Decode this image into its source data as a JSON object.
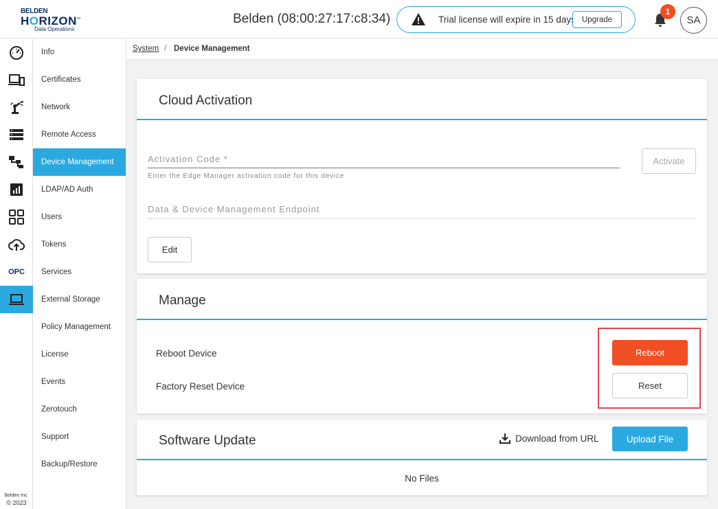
{
  "header": {
    "logo_line1": "BELDEN",
    "logo_line2_a": "H",
    "logo_line2_o": "O",
    "logo_line2_b": "RIZON",
    "logo_tm": "™",
    "logo_line3": "Data Operations",
    "device_title": "Belden (08:00:27:17:c8:34)",
    "license_message": "Trial license will expire in 15 days",
    "upgrade_label": "Upgrade",
    "notification_count": "1",
    "avatar_initials": "SA"
  },
  "rail": {
    "items": [
      "dashboard-icon",
      "devices-icon",
      "robot-arm-icon",
      "list-icon",
      "hierarchy-icon",
      "chart-icon",
      "apps-grid-icon",
      "cloud-upload-icon",
      "opc-icon",
      "laptop-icon"
    ],
    "opc_label": "OPC",
    "footer_company": "Belden Inc.",
    "footer_year": "© 2023"
  },
  "subnav": {
    "items": [
      "Info",
      "Certificates",
      "Network",
      "Remote Access",
      "Device Management",
      "LDAP/AD Auth",
      "Users",
      "Tokens",
      "Services",
      "External Storage",
      "Policy Management",
      "License",
      "Events",
      "Zerotouch",
      "Support",
      "Backup/Restore"
    ],
    "active": "Device Management"
  },
  "breadcrumb": {
    "parent": "System",
    "separator": "/",
    "current": "Device Management"
  },
  "cloud_activation": {
    "title": "Cloud Activation",
    "activation_code_label": "Activation Code *",
    "activation_code_hint": "Enter the Edge Manager activation code for this device",
    "activate_label": "Activate",
    "endpoint_label": "Data & Device Management Endpoint",
    "edit_label": "Edit"
  },
  "manage": {
    "title": "Manage",
    "reboot_row_label": "Reboot Device",
    "reboot_button": "Reboot",
    "reset_row_label": "Factory Reset Device",
    "reset_button": "Reset"
  },
  "software_update": {
    "title": "Software Update",
    "download_label": "Download from URL",
    "upload_label": "Upload File",
    "empty_text": "No Files"
  },
  "colors": {
    "accent": "#2aa9e0",
    "danger": "#f04e23",
    "highlight_box": "#e0454c",
    "brand_navy": "#0b2d5b"
  }
}
